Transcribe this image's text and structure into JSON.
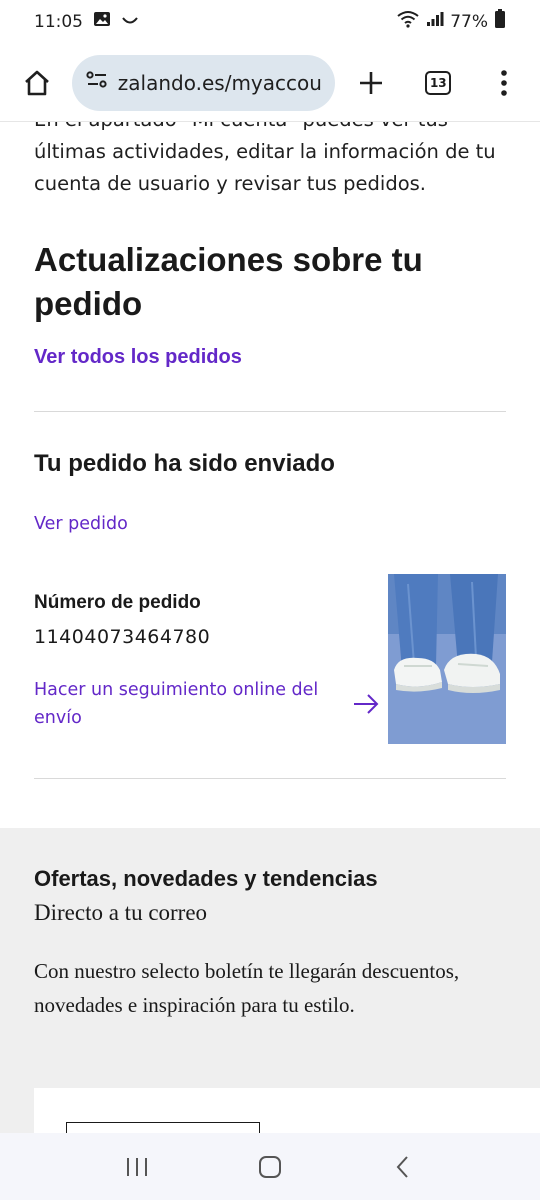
{
  "status_bar": {
    "time": "11:05",
    "battery": "77%",
    "icons": [
      "image-icon",
      "smile-notification-icon",
      "wifi-icon",
      "signal-icon",
      "battery-icon"
    ]
  },
  "browser": {
    "url": "zalando.es/myaccou",
    "tab_count": "13",
    "icons": [
      "home-icon",
      "site-settings-icon",
      "new-tab-plus-icon",
      "tabs-icon",
      "overflow-menu-icon"
    ]
  },
  "page": {
    "intro_partial": "En el apartado \"Mi cuenta\" puedes ver tus",
    "intro": "últimas actividades, editar la información de tu cuenta de usuario y revisar tus pedidos.",
    "updates_heading": "Actualizaciones sobre tu pedido",
    "view_all_orders": "Ver todos los pedidos",
    "order_status": "Tu pedido ha sido enviado",
    "view_order": "Ver pedido",
    "order_number_label": "Número de pedido",
    "order_number": "11404073464780",
    "tracking_link": "Hacer un seguimiento online del envío"
  },
  "newsletter": {
    "title": "Ofertas, novedades y tendencias",
    "subtitle": "Directo a tu correo",
    "body": "Con nuestro selecto boletín te llegarán descuentos, novedades e inspiración para tu estilo."
  },
  "nav": {
    "icons": [
      "recent-apps-icon",
      "home-circle-icon",
      "back-icon"
    ]
  },
  "colors": {
    "accent": "#6328c8",
    "url_pill": "#dde6ee",
    "newsletter_bg": "#efefef"
  }
}
